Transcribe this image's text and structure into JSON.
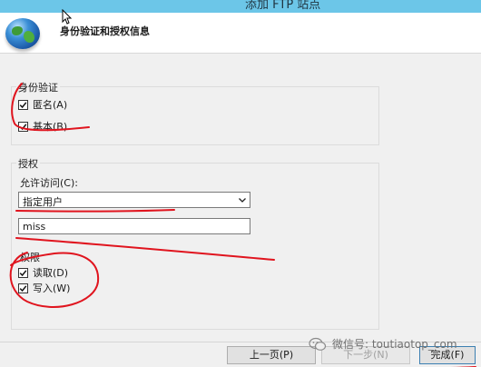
{
  "window": {
    "title": "添加 FTP 站点"
  },
  "header": {
    "heading": "身份验证和授权信息"
  },
  "authentication": {
    "group_title": "身份验证",
    "anonymous": {
      "label": "匿名(A)",
      "checked": true
    },
    "basic": {
      "label": "基本(B)",
      "checked": true
    }
  },
  "authorization": {
    "group_title": "授权",
    "allow_access_label": "允许访问(C):",
    "allow_access_value": "指定用户",
    "user_value": "miss",
    "permissions_label": "权限",
    "read": {
      "label": "读取(D)",
      "checked": true
    },
    "write": {
      "label": "写入(W)",
      "checked": true
    }
  },
  "buttons": {
    "previous": "上一页(P)",
    "next": "下一步(N)",
    "finish": "完成(F)"
  },
  "watermark": {
    "text": "微信号: toutiaotop_com"
  },
  "colors": {
    "titlebar": "#6cc6e8",
    "annotation": "#e0141e"
  },
  "icons": [
    "globe-icon",
    "checkmark-icon",
    "chevron-down-icon",
    "wechat-icon",
    "mouse-cursor-icon"
  ]
}
